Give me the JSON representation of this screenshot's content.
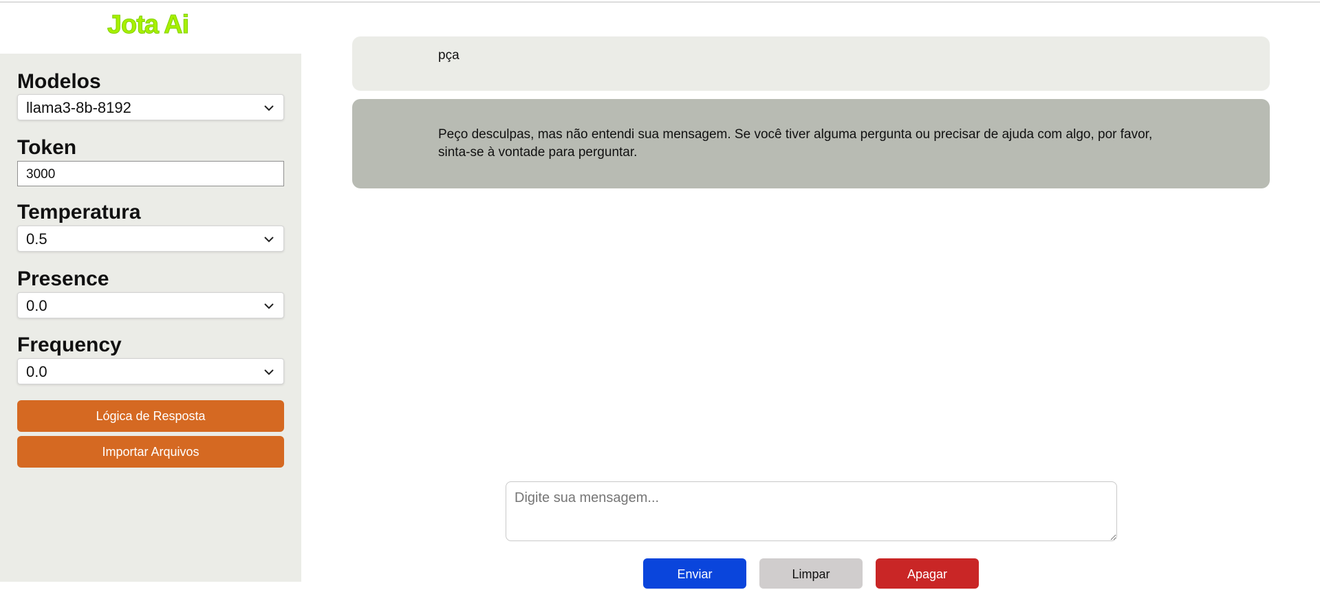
{
  "app": {
    "logo_text": "Jota Ai"
  },
  "sidebar": {
    "models_label": "Modelos",
    "model_value": "llama3-8b-8192",
    "token_label": "Token",
    "token_value": "3000",
    "temperature_label": "Temperatura",
    "temperature_value": "0.5",
    "presence_label": "Presence",
    "presence_value": "0.0",
    "frequency_label": "Frequency",
    "frequency_value": "0.0",
    "logic_button": "Lógica de Resposta",
    "import_button": "Importar Arquivos"
  },
  "chat": {
    "messages": [
      {
        "role": "user",
        "text": "pça"
      },
      {
        "role": "assistant",
        "text": "Peço desculpas, mas não entendi sua mensagem. Se você tiver alguma pergunta ou precisar de ajuda com algo, por favor, sinta-se à vontade para perguntar."
      }
    ],
    "input_placeholder": "Digite sua mensagem...",
    "input_value": ""
  },
  "actions": {
    "send": "Enviar",
    "clear": "Limpar",
    "delete": "Apagar"
  },
  "colors": {
    "logo": "#a8f000",
    "sidebar_bg": "#ebece7",
    "accent_orange": "#d56922",
    "send_blue": "#0a45dc",
    "clear_gray": "#d0cdcd",
    "delete_red": "#c92626",
    "user_bubble": "#ebece7",
    "assistant_bubble": "#b8bbb3"
  },
  "icons": {
    "select_arrow": "chevron-down-icon"
  }
}
